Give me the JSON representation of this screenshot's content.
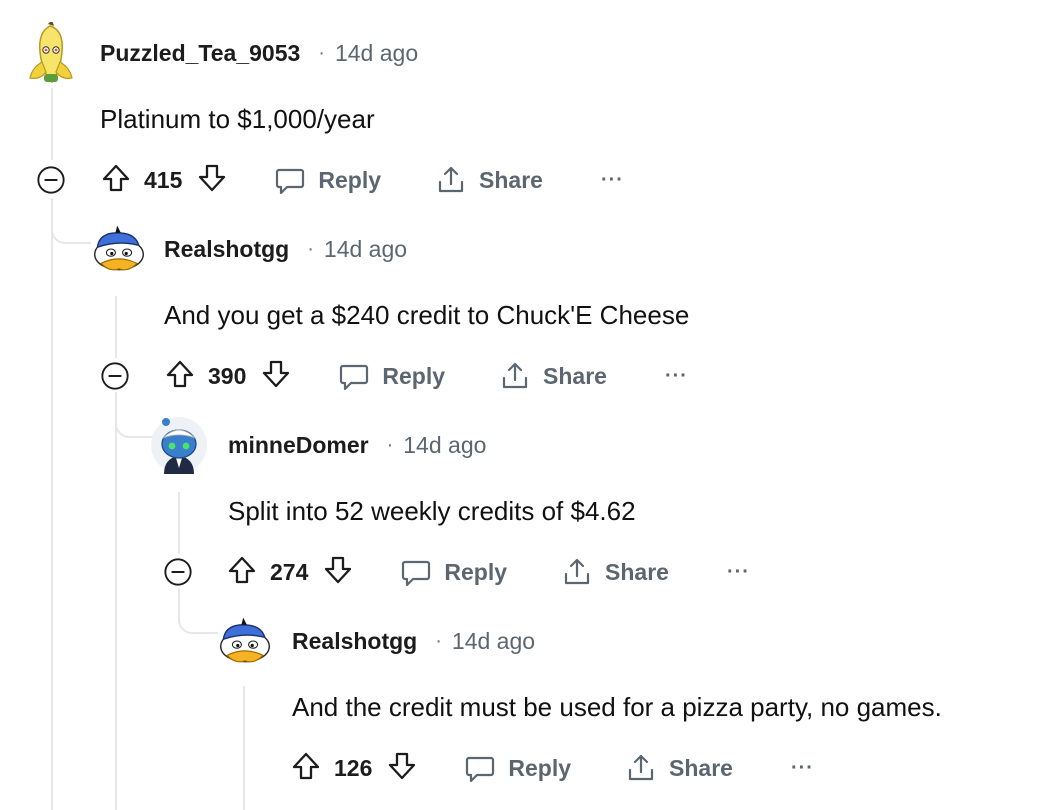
{
  "comments": [
    {
      "author": "Puzzled_Tea_9053",
      "separator": "·",
      "time": "14d ago",
      "body": "Platinum to $1,000/year",
      "score": "415",
      "reply_label": "Reply",
      "share_label": "Share",
      "more_label": "···",
      "avatar_icon": "banana-avatar-icon"
    },
    {
      "author": "Realshotgg",
      "separator": "·",
      "time": "14d ago",
      "body": "And you get a $240 credit to Chuck'E Cheese",
      "score": "390",
      "reply_label": "Reply",
      "share_label": "Share",
      "more_label": "···",
      "avatar_icon": "duck-avatar-icon"
    },
    {
      "author": "minneDomer",
      "separator": "·",
      "time": "14d ago",
      "body": "Split into 52 weekly credits of $4.62",
      "score": "274",
      "reply_label": "Reply",
      "share_label": "Share",
      "more_label": "···",
      "avatar_icon": "snoo-avatar-icon"
    },
    {
      "author": "Realshotgg",
      "separator": "·",
      "time": "14d ago",
      "body": "And the credit must be used for a pizza party, no games.",
      "score": "126",
      "reply_label": "Reply",
      "share_label": "Share",
      "more_label": "···",
      "avatar_icon": "duck-avatar-icon"
    }
  ],
  "colors": {
    "thread_line": "#e5e7eb",
    "meta_text": "#5c6670",
    "text": "#1c1c1c"
  }
}
